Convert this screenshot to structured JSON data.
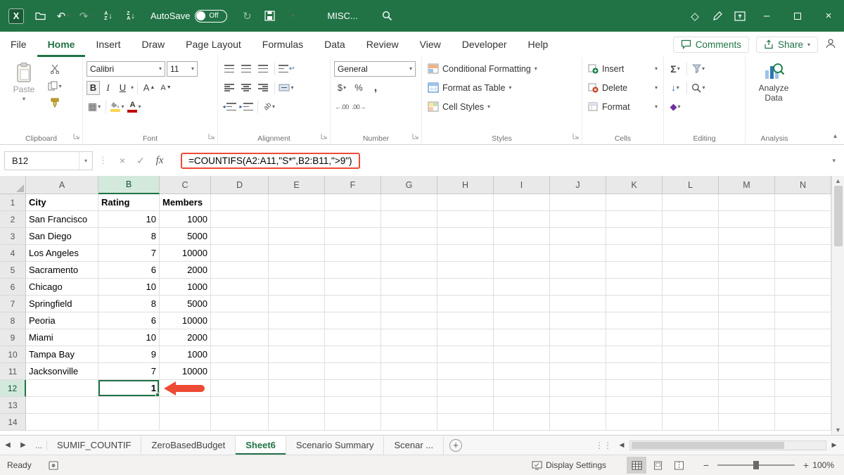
{
  "colors": {
    "accent_green": "#217346",
    "highlight_red": "#ee4b36"
  },
  "title_bar": {
    "autosave_label": "AutoSave",
    "autosave_state": "Off",
    "document_title": "MISC...",
    "icons": [
      "excel-app",
      "open-folder",
      "undo",
      "redo",
      "sort-ascending",
      "sort-descending",
      "refresh",
      "save",
      "more-commands",
      "search",
      "diamond",
      "ink-pen",
      "ribbon-options",
      "minimize",
      "maximize",
      "close"
    ]
  },
  "ribbon_tabs": {
    "items": [
      "File",
      "Home",
      "Insert",
      "Draw",
      "Page Layout",
      "Formulas",
      "Data",
      "Review",
      "View",
      "Developer",
      "Help"
    ],
    "active": "Home",
    "comments_label": "Comments",
    "share_label": "Share"
  },
  "ribbon": {
    "clipboard": {
      "label": "Clipboard",
      "paste_label": "Paste"
    },
    "font": {
      "label": "Font",
      "font_name": "Calibri",
      "font_size": "11",
      "bold": "B",
      "italic": "I",
      "underline": "U",
      "grow": "A",
      "shrink": "A"
    },
    "alignment": {
      "label": "Alignment"
    },
    "number": {
      "label": "Number",
      "format": "General",
      "currency": "$",
      "percent": "%",
      "comma": ",",
      "increase_decimal": "←.00",
      "decrease_decimal": ".00→"
    },
    "styles": {
      "label": "Styles",
      "items": [
        "Conditional Formatting",
        "Format as Table",
        "Cell Styles"
      ]
    },
    "cells": {
      "label": "Cells",
      "items": [
        "Insert",
        "Delete",
        "Format"
      ]
    },
    "editing": {
      "label": "Editing",
      "autosum": "Σ"
    },
    "analysis": {
      "label": "Analysis",
      "button": "Analyze Data"
    }
  },
  "formula_bar": {
    "name_box": "B12",
    "fx_label": "fx",
    "formula": "=COUNTIFS(A2:A11,\"S*\",B2:B11,\">9\")"
  },
  "grid": {
    "columns": [
      "A",
      "B",
      "C",
      "D",
      "E",
      "F",
      "G",
      "H",
      "I",
      "J",
      "K",
      "L",
      "M",
      "N"
    ],
    "row_labels": [
      "1",
      "2",
      "3",
      "4",
      "5",
      "6",
      "7",
      "8",
      "9",
      "10",
      "11",
      "12",
      "13",
      "14"
    ],
    "cells": [
      [
        "City",
        "Rating",
        "Members"
      ],
      [
        "San Francisco",
        "10",
        "1000"
      ],
      [
        "San Diego",
        "8",
        "5000"
      ],
      [
        "Los Angeles",
        "7",
        "10000"
      ],
      [
        "Sacramento",
        "6",
        "2000"
      ],
      [
        "Chicago",
        "10",
        "1000"
      ],
      [
        "Springfield",
        "8",
        "5000"
      ],
      [
        "Peoria",
        "6",
        "10000"
      ],
      [
        "Miami",
        "10",
        "2000"
      ],
      [
        "Tampa Bay",
        "9",
        "1000"
      ],
      [
        "Jacksonville",
        "7",
        "10000"
      ],
      [
        "",
        "1",
        ""
      ],
      [
        "",
        "",
        ""
      ],
      [
        "",
        "",
        ""
      ]
    ],
    "selected_cell": {
      "ref": "B12",
      "row": 12,
      "column": "B",
      "value": "1"
    }
  },
  "sheet_bar": {
    "overflow": "...",
    "tabs": [
      "SUMIF_COUNTIF",
      "ZeroBasedBudget",
      "Sheet6",
      "Scenario Summary",
      "Scenar ..."
    ],
    "active": "Sheet6"
  },
  "status_bar": {
    "mode": "Ready",
    "display_settings": "Display Settings",
    "zoom_level": "100%"
  }
}
